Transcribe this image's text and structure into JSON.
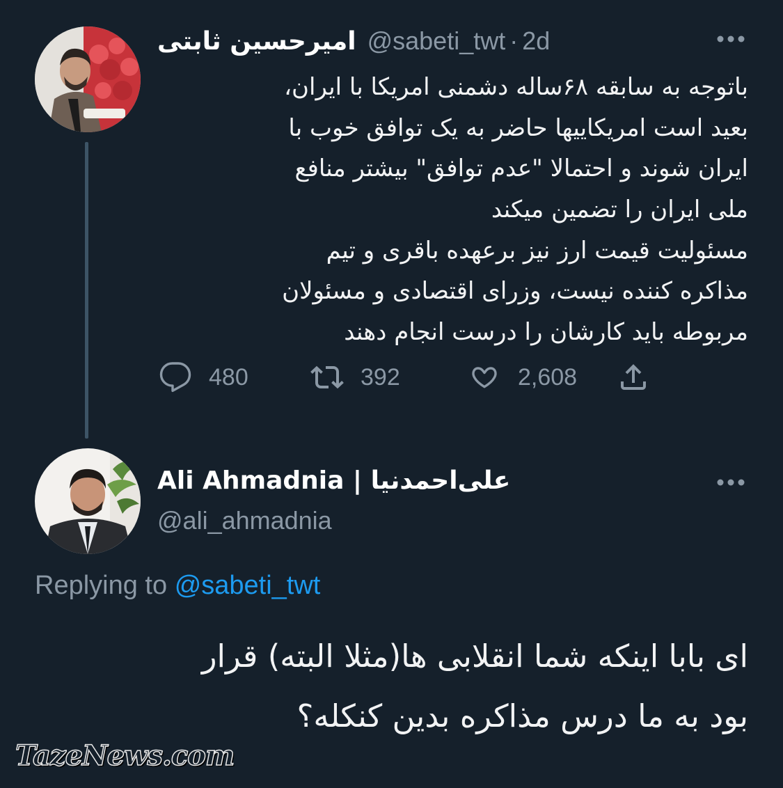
{
  "tweet": {
    "author_name": "امیرحسین ثابتی",
    "handle": "@sabeti_twt",
    "separator": "·",
    "time_ago": "2d",
    "lines": [
      "باتوجه به سابقه ۶۸ساله دشمنی امریکا با ایران،",
      "بعید است امریکاییها حاضر به یک توافق خوب با",
      "ایران شوند و احتمالا \"عدم توافق\" بیشتر منافع",
      "ملی ایران را تضمین میکند",
      "مسئولیت قیمت ارز نیز برعهده باقری و تیم",
      "مذاکره کننده نیست، وزرای اقتصادی و مسئولان",
      "مربوطه باید کارشان را درست انجام دهند"
    ],
    "stats": {
      "replies": "480",
      "retweets": "392",
      "likes": "2,608"
    }
  },
  "reply": {
    "author_name": "Ali Ahmadnia | علی‌احمدنیا",
    "handle": "@ali_ahmadnia",
    "replying_prefix": "Replying to",
    "replying_mention": "@sabeti_twt",
    "lines": [
      "ای بابا اینکه شما انقلابی ها(مثلا البته) قرار",
      "بود به ما درس مذاکره بدین کنکله؟"
    ]
  },
  "watermark": "TazeNews.com",
  "icons": {
    "more": "more-horizontal-icon",
    "reply": "reply-bubble-icon",
    "retweet": "retweet-icon",
    "like": "heart-icon",
    "share": "share-icon"
  },
  "colors": {
    "background": "#15202b",
    "secondary_text": "#8b98a5",
    "link": "#1d9bf0",
    "thread_line": "#3d5466"
  }
}
